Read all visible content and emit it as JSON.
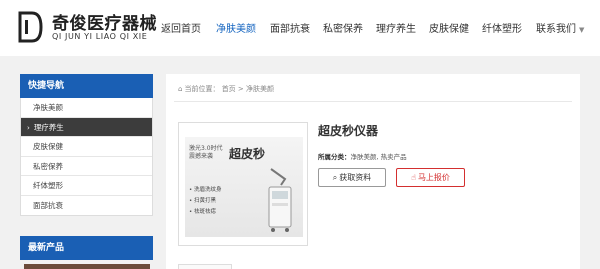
{
  "logo": {
    "name": "奇俊医疗器械",
    "english": "QI JUN YI LIAO QI XIE"
  },
  "nav": {
    "items": [
      {
        "label": "返回首页"
      },
      {
        "label": "净肤美颜"
      },
      {
        "label": "面部抗衰"
      },
      {
        "label": "私密保养"
      },
      {
        "label": "理疗养生"
      },
      {
        "label": "皮肤保健"
      },
      {
        "label": "纤体塑形"
      },
      {
        "label": "联系我们"
      }
    ],
    "active_index": 1,
    "caret_icon": "chevron-down-icon"
  },
  "sidebar": {
    "title": "快捷导航",
    "items": [
      {
        "label": "净肤美颜"
      },
      {
        "label": "理疗养生"
      },
      {
        "label": "皮肤保健"
      },
      {
        "label": "私密保养"
      },
      {
        "label": "纤体塑形"
      },
      {
        "label": "面部抗衰"
      }
    ],
    "active_index": 1,
    "arrow": "›",
    "section2_title": "最新产品"
  },
  "breadcrumb": {
    "home_icon": "home-icon",
    "prefix": "当前位置：",
    "home": "首页",
    "sep": ">",
    "current": "净肤美颜"
  },
  "product": {
    "title": "超皮秒仪器",
    "category_label": "所属分类：",
    "category_value": "净肤美颜, 热卖产品",
    "image": {
      "small_text": "激光3.0时代 震撼来袭",
      "big_text": "超皮秒",
      "bullets": [
        "• 洗眉洗纹身",
        "• 扫黄打黑",
        "• 祛斑祛痣"
      ]
    },
    "btn_doc": "获取资料",
    "btn_quote": "马上报价"
  },
  "colors": {
    "brand_blue": "#1a5fb4",
    "accent_red": "#d32f2f",
    "active_nav": "#1565c0"
  }
}
